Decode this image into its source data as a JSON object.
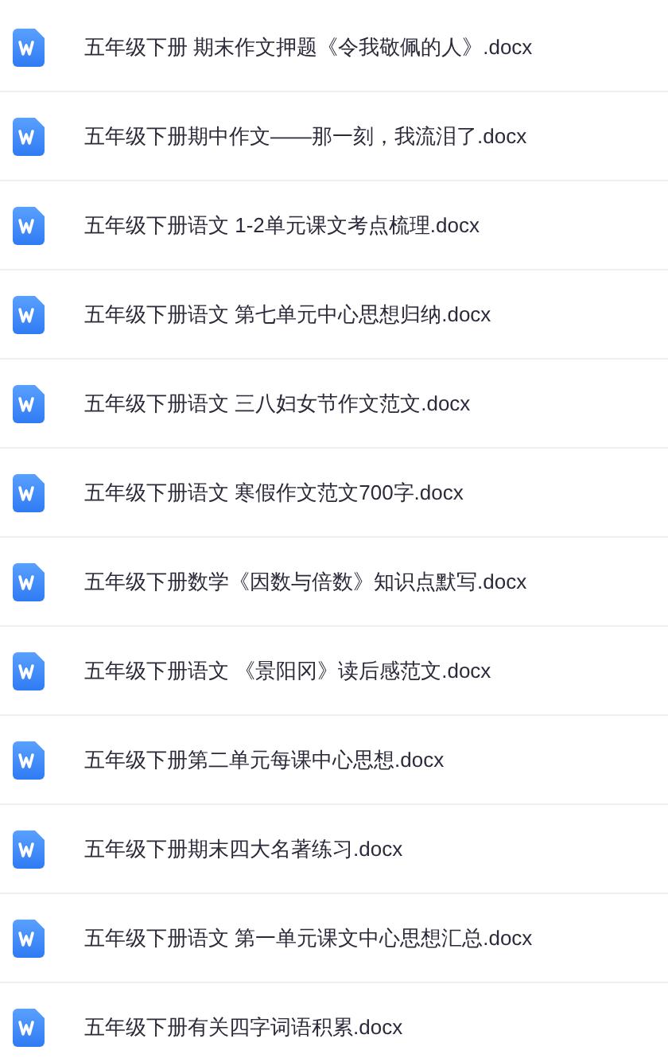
{
  "files": [
    {
      "name": "五年级下册 期末作文押题《令我敬佩的人》.docx"
    },
    {
      "name": "五年级下册期中作文——那一刻，我流泪了.docx"
    },
    {
      "name": "五年级下册语文 1-2单元课文考点梳理.docx"
    },
    {
      "name": "五年级下册语文 第七单元中心思想归纳.docx"
    },
    {
      "name": "五年级下册语文 三八妇女节作文范文.docx"
    },
    {
      "name": "五年级下册语文 寒假作文范文700字.docx"
    },
    {
      "name": "五年级下册数学《因数与倍数》知识点默写.docx"
    },
    {
      "name": "五年级下册语文 《景阳冈》读后感范文.docx"
    },
    {
      "name": "五年级下册第二单元每课中心思想.docx"
    },
    {
      "name": "五年级下册期末四大名著练习.docx"
    },
    {
      "name": "五年级下册语文 第一单元课文中心思想汇总.docx"
    },
    {
      "name": "五年级下册有关四字词语积累.docx"
    }
  ]
}
